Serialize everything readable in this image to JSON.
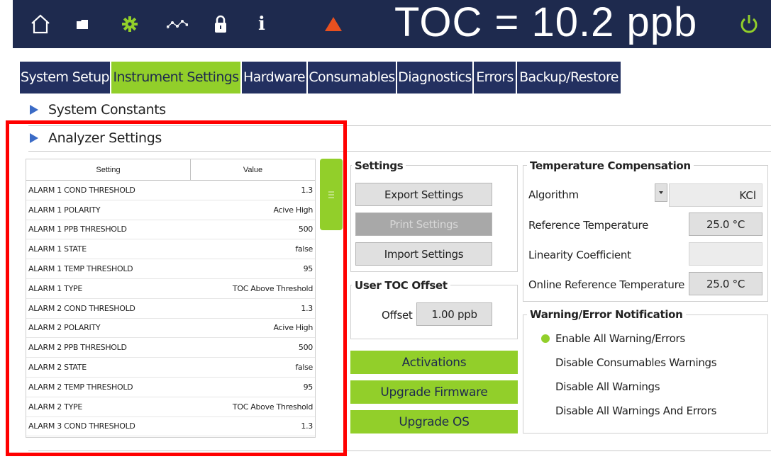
{
  "header": {
    "title": "TOC = 10.2 ppb",
    "icons": [
      "home-icon",
      "folder-icon",
      "gear-icon",
      "trend-graph-icon",
      "lock-icon",
      "info-icon",
      "warning-triangle-icon",
      "power-icon"
    ],
    "info_glyph": "i",
    "colors": {
      "bar": "#1e2a4e",
      "accent": "#92cf2a",
      "warning": "#e8501f"
    }
  },
  "tabs": [
    {
      "label": "System Setup",
      "active": false
    },
    {
      "label": "Instrument Settings",
      "active": true
    },
    {
      "label": "Hardware",
      "active": false
    },
    {
      "label": "Consumables",
      "active": false
    },
    {
      "label": "Diagnostics",
      "active": false
    },
    {
      "label": "Errors",
      "active": false
    },
    {
      "label": "Backup/Restore",
      "active": false
    }
  ],
  "sections": {
    "system_constants": "System Constants",
    "analyzer_settings": "Analyzer Settings"
  },
  "settings_table": {
    "headers": {
      "setting": "Setting",
      "value": "Value"
    },
    "rows": [
      {
        "setting": "ALARM 1 COND THRESHOLD",
        "value": "1.3"
      },
      {
        "setting": "ALARM 1 POLARITY",
        "value": "Acive High"
      },
      {
        "setting": "ALARM 1 PPB THRESHOLD",
        "value": "500"
      },
      {
        "setting": "ALARM 1 STATE",
        "value": "false"
      },
      {
        "setting": "ALARM 1 TEMP THRESHOLD",
        "value": "95"
      },
      {
        "setting": "ALARM 1 TYPE",
        "value": "TOC Above Threshold"
      },
      {
        "setting": "ALARM 2 COND THRESHOLD",
        "value": "1.3"
      },
      {
        "setting": "ALARM 2 POLARITY",
        "value": "Acive High"
      },
      {
        "setting": "ALARM 2 PPB THRESHOLD",
        "value": "500"
      },
      {
        "setting": "ALARM 2 STATE",
        "value": "false"
      },
      {
        "setting": "ALARM 2 TEMP THRESHOLD",
        "value": "95"
      },
      {
        "setting": "ALARM 2 TYPE",
        "value": "TOC Above Threshold"
      },
      {
        "setting": "ALARM 3 COND THRESHOLD",
        "value": "1.3"
      }
    ]
  },
  "settings_group": {
    "title": "Settings",
    "export_label": "Export Settings",
    "print_label": "Print Settings",
    "import_label": "Import Settings"
  },
  "user_toc_offset": {
    "title": "User TOC Offset",
    "label": "Offset",
    "value": "1.00 ppb"
  },
  "actions": {
    "activations": "Activations",
    "upgrade_firmware": "Upgrade Firmware",
    "upgrade_os": "Upgrade OS"
  },
  "temperature_compensation": {
    "title": "Temperature Compensation",
    "algorithm_label": "Algorithm",
    "algorithm_value": "KCl",
    "ref_temp_label": "Reference Temperature",
    "ref_temp_value": "25.0 °C",
    "linearity_label": "Linearity Coefficient",
    "linearity_value": "",
    "online_ref_label": "Online Reference Temperature",
    "online_ref_value": "25.0 °C"
  },
  "notification": {
    "title": "Warning/Error Notification",
    "options": [
      {
        "label": "Enable All Warning/Errors",
        "selected": true
      },
      {
        "label": "Disable Consumables Warnings",
        "selected": false
      },
      {
        "label": "Disable All Warnings",
        "selected": false
      },
      {
        "label": "Disable All Warnings And Errors",
        "selected": false
      }
    ]
  }
}
